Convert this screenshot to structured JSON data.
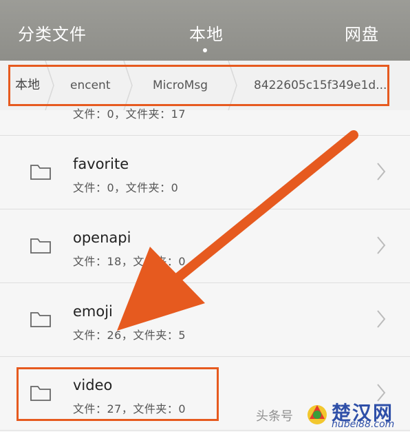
{
  "tabs": {
    "category": "分类文件",
    "local": "本地",
    "cloud": "网盘"
  },
  "breadcrumb": [
    "本地",
    "encent",
    "MicroMsg",
    "8422605c15f349e1d..."
  ],
  "partial_item_meta": "文件：0，文件夹：17",
  "items": [
    {
      "name": "favorite",
      "meta": "文件：0，文件夹：0"
    },
    {
      "name": "openapi",
      "meta": "文件：18，文件夹：0"
    },
    {
      "name": "emoji",
      "meta": "文件：26，文件夹：5"
    },
    {
      "name": "video",
      "meta": "文件：27，文件夹：0"
    }
  ],
  "watermark": {
    "text": "头条号",
    "brand": "楚汉网",
    "url": "hubei88.com"
  },
  "colors": {
    "accent": "#e65a1f",
    "topbar": "#95958f"
  }
}
